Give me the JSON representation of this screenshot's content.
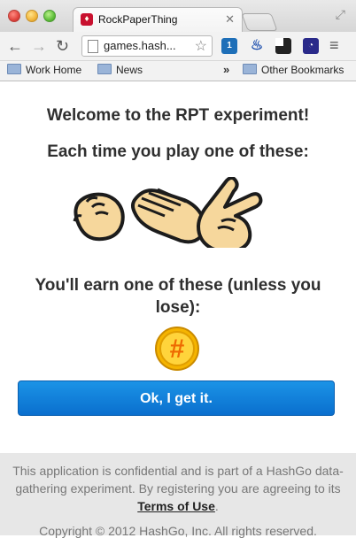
{
  "browser": {
    "tab_title": "RockPaperThing",
    "url": "games.hash...",
    "bookmarks": [
      "Work Home",
      "News",
      "Other Bookmarks"
    ]
  },
  "page": {
    "welcome": "Welcome to the RPT experiment!",
    "each_time": "Each time you play one of these:",
    "earn": "You'll earn one of these (unless you lose):",
    "coin_symbol": "#",
    "ok_button": "Ok, I get it.",
    "footer_text": "This application is confidential and is part of a HashGo data-gathering experiment. By registering you are agreeing to its",
    "terms_link": "Terms of Use",
    "copyright": "Copyright © 2012 HashGo, Inc. All rights reserved."
  },
  "icons": {
    "hands": [
      "rock-hand-icon",
      "paper-hand-icon",
      "scissors-hand-icon"
    ],
    "coin": "hash-coin-icon"
  },
  "colors": {
    "button": "#0a6fce",
    "coin": "#f5b400",
    "footer_bg": "#e7e7e7"
  }
}
